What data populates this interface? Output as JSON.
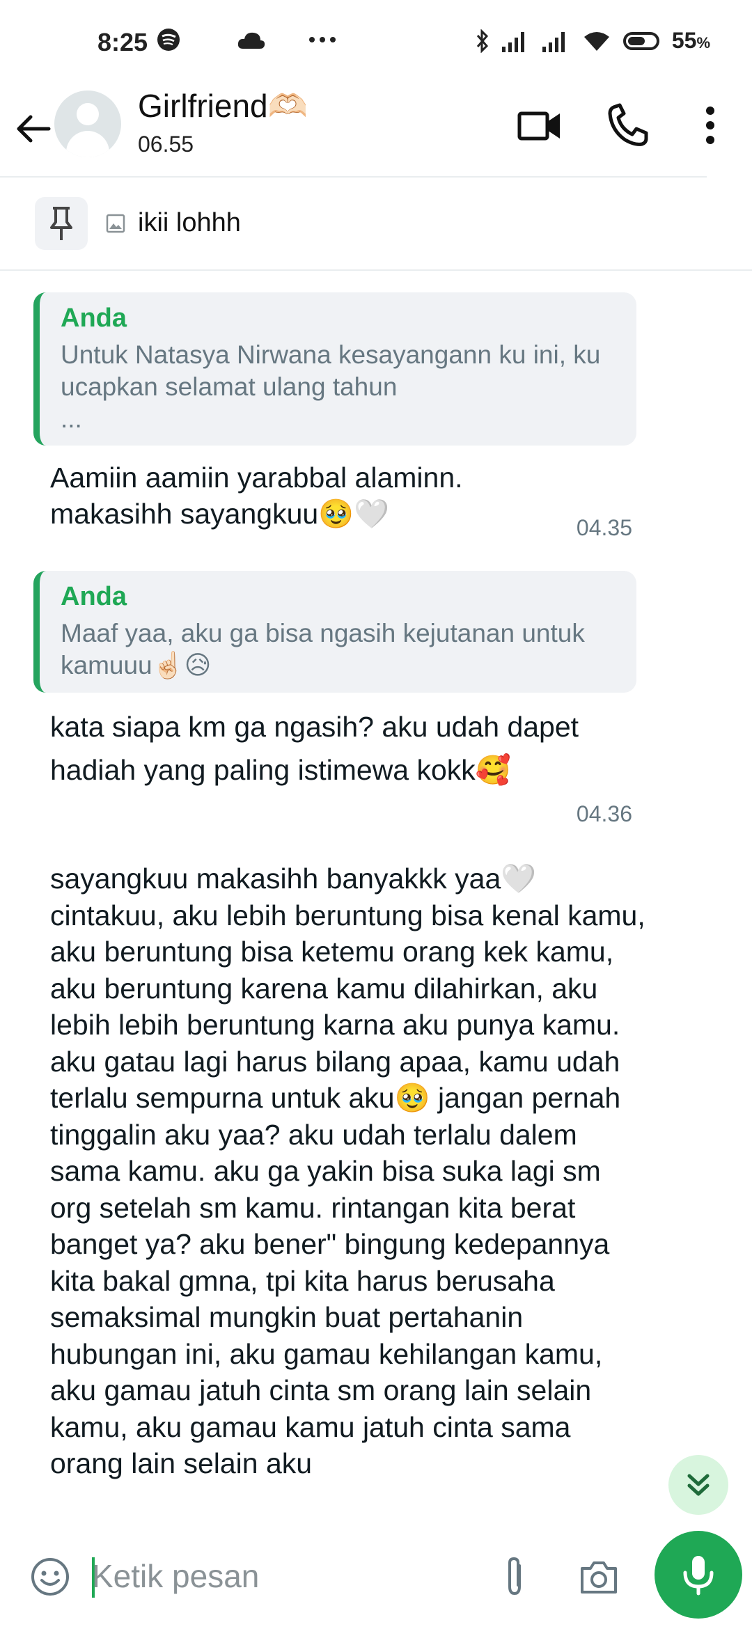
{
  "status_bar": {
    "time": "8:25",
    "battery": "55",
    "battery_unit": "%",
    "icons": [
      "spotify-icon",
      "cloud-icon",
      "more-dots-icon",
      "bluetooth-icon",
      "signal-icon",
      "signal-icon",
      "wifi-icon",
      "battery-icon"
    ]
  },
  "header": {
    "title": "Girlfriend🫶🏻",
    "subtitle": "06.55",
    "icons": [
      "back-arrow-icon",
      "video-call-icon",
      "phone-icon",
      "more-vert-icon"
    ]
  },
  "pinned": {
    "text": "ikii lohhh",
    "icons": [
      "pin-icon",
      "image-icon"
    ]
  },
  "messages": [
    {
      "quote_author": "Anda",
      "quote_text": "Untuk Natasya Nirwana kesayangann ku ini, ku ucapkan selamat ulang tahun",
      "quote_ellipsis": "...",
      "text": "Aamiin aamiin yarabbal alaminn. makasihh sayangkuu🥹🤍",
      "time": "04.35"
    },
    {
      "quote_author": "Anda",
      "quote_text": "Maaf yaa, aku ga bisa ngasih kejutanan untuk kamuuu☝🏻😥",
      "text": "kata siapa km ga ngasih? aku udah dapet hadiah yang paling istimewa kokk🥰",
      "time": "04.36"
    },
    {
      "text": "sayangkuu makasihh banyakkk yaa🤍 cintakuu, aku lebih beruntung bisa kenal kamu, aku beruntung bisa ketemu orang kek kamu, aku beruntung karena kamu dilahirkan, aku lebih lebih beruntung karna aku punya kamu. aku gatau lagi harus bilang apaa, kamu udah terlalu sempurna untuk aku🥹 jangan pernah tinggalin aku yaa? aku udah terlalu dalem sama kamu. aku ga yakin bisa suka lagi sm org setelah sm kamu. rintangan kita berat banget ya? aku bener\" bingung kedepannya kita bakal gmna, tpi kita harus berusaha semaksimal mungkin buat pertahanin hubungan ini, aku gamau kehilangan kamu, aku gamau jatuh cinta sm orang lain selain kamu, aku gamau kamu jatuh cinta sama orang lain selain aku"
    }
  ],
  "input": {
    "placeholder": "Ketik pesan",
    "icons": [
      "emoji-icon",
      "attach-icon",
      "camera-icon",
      "mic-icon",
      "scroll-down-icon"
    ]
  },
  "colors": {
    "accent": "#1fa855",
    "quote_bg": "#f0f2f5",
    "secondary_text": "#667781",
    "scroll_fab_bg": "#d8f5de"
  }
}
